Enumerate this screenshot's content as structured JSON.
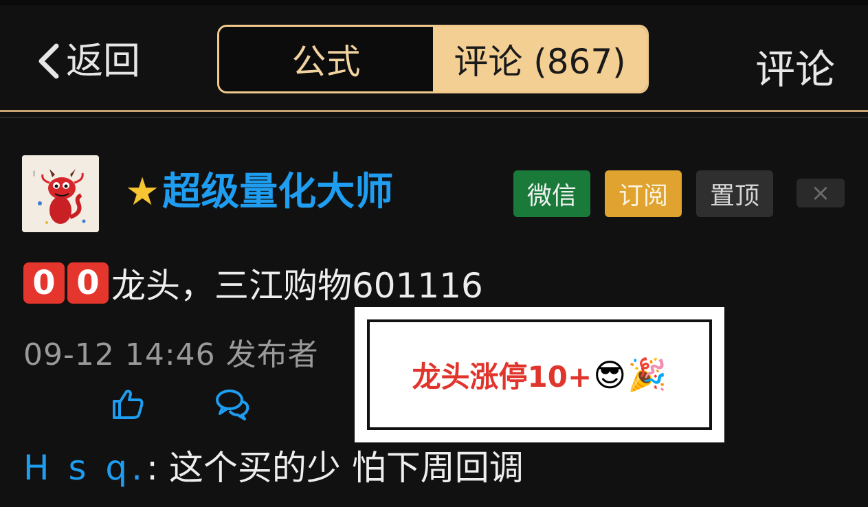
{
  "header": {
    "back_label": "返回",
    "tabs": [
      {
        "label": "公式",
        "active": false
      },
      {
        "label": "评论 (867)",
        "active": true
      }
    ],
    "right_action": "评论"
  },
  "post": {
    "username": "超级量化大师",
    "buttons": {
      "wechat": "微信",
      "subscribe": "订阅",
      "pin": "置顶",
      "close": "×"
    },
    "content_prefix_keycaps": [
      "0",
      "0"
    ],
    "content_text": "龙头，三江购物601116",
    "meta": "09-12 14:46  发布者"
  },
  "reply": {
    "user": "H s q.",
    "separator": ": ",
    "text": "这个买的少 怕下周回调"
  },
  "overlay": {
    "text": "龙头涨停10+",
    "emoji_1": "😎",
    "emoji_2": "🎉"
  },
  "colors": {
    "accent_gold": "#f3cf93",
    "link_blue": "#1e9df1",
    "wechat_green": "#1a7a3a",
    "subscribe_orange": "#e0a32f",
    "overlay_red": "#e0352c"
  }
}
